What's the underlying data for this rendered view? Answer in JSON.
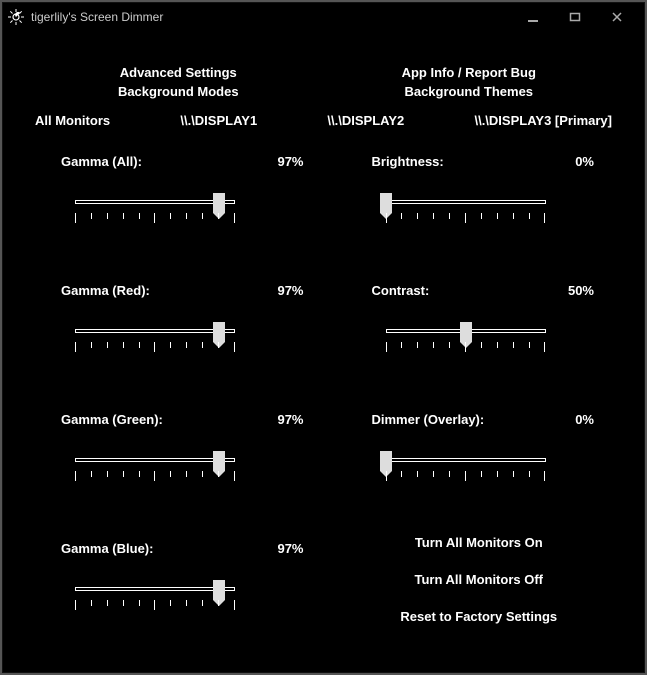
{
  "window": {
    "title": "tigerlily's Screen Dimmer"
  },
  "links": {
    "left1": "Advanced Settings",
    "left2": "Background Modes",
    "right1": "App Info / Report Bug",
    "right2": "Background Themes"
  },
  "tabs": {
    "t0": "All Monitors",
    "t1": "\\\\.\\DISPLAY1",
    "t2": "\\\\.\\DISPLAY2",
    "t3": "\\\\.\\DISPLAY3 [Primary]"
  },
  "sliders": {
    "gamma_all": {
      "label": "Gamma (All):",
      "value": "97%",
      "pos": 90
    },
    "gamma_red": {
      "label": "Gamma (Red):",
      "value": "97%",
      "pos": 90
    },
    "gamma_green": {
      "label": "Gamma (Green):",
      "value": "97%",
      "pos": 90
    },
    "gamma_blue": {
      "label": "Gamma (Blue):",
      "value": "97%",
      "pos": 90
    },
    "brightness": {
      "label": "Brightness:",
      "value": "0%",
      "pos": 0
    },
    "contrast": {
      "label": "Contrast:",
      "value": "50%",
      "pos": 50
    },
    "dimmer": {
      "label": "Dimmer (Overlay):",
      "value": "0%",
      "pos": 0
    }
  },
  "actions": {
    "on": "Turn All Monitors On",
    "off": "Turn All Monitors Off",
    "reset": "Reset to Factory Settings"
  }
}
